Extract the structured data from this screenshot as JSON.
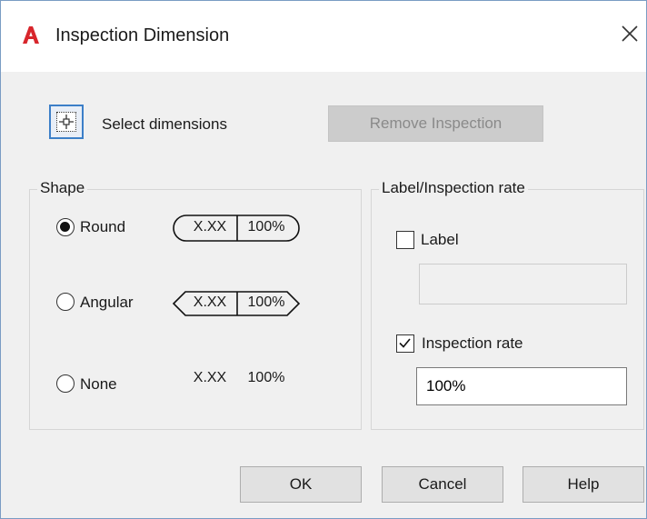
{
  "window": {
    "title": "Inspection Dimension",
    "app_icon": "autocad-a-icon",
    "close_icon": "close-icon"
  },
  "select_dimensions": {
    "icon": "pick-point-icon",
    "label": "Select dimensions"
  },
  "remove_inspection": {
    "label": "Remove Inspection",
    "enabled": false
  },
  "shape": {
    "title": "Shape",
    "selected": "Round",
    "options": [
      {
        "label": "Round",
        "preview_value": "X.XX",
        "preview_rate": "100%"
      },
      {
        "label": "Angular",
        "preview_value": "X.XX",
        "preview_rate": "100%"
      },
      {
        "label": "None",
        "preview_value": "X.XX",
        "preview_rate": "100%"
      }
    ]
  },
  "label_rate": {
    "title": "Label/Inspection rate",
    "label_checkbox": {
      "label": "Label",
      "checked": false
    },
    "label_field": {
      "value": "",
      "enabled": false
    },
    "rate_checkbox": {
      "label": "Inspection rate",
      "checked": true
    },
    "rate_field": {
      "value": "100%"
    }
  },
  "buttons": {
    "ok": "OK",
    "cancel": "Cancel",
    "help": "Help"
  },
  "colors": {
    "app_icon_red": "#d8262c",
    "focus_blue": "#3c7fc8",
    "dialog_bg": "#f0f0f0"
  }
}
